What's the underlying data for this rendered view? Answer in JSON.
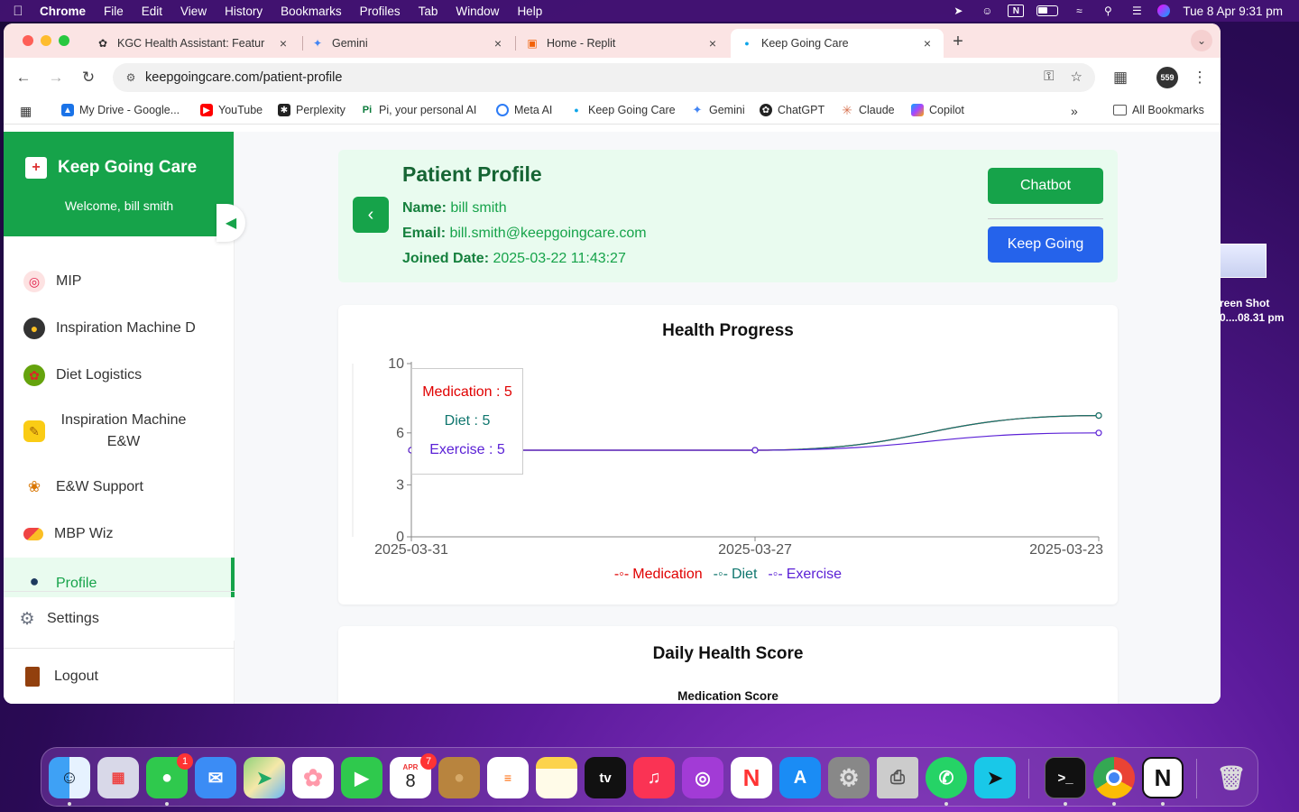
{
  "menubar": {
    "app": "Chrome",
    "items": [
      "File",
      "Edit",
      "View",
      "History",
      "Bookmarks",
      "Profiles",
      "Tab",
      "Window",
      "Help"
    ],
    "datetime": "Tue 8 Apr  9:31 pm"
  },
  "desktop": {
    "file_label_1": "reen Shot",
    "file_label_2": "0....08.31 pm"
  },
  "tabs": [
    {
      "title": "KGC Health Assistant: Featur",
      "icon": "kgc-icon"
    },
    {
      "title": "Gemini",
      "icon": "gemini-icon"
    },
    {
      "title": "Home - Replit",
      "icon": "replit-icon"
    },
    {
      "title": "Keep Going Care",
      "icon": "kgc-dot-icon"
    }
  ],
  "address": {
    "url": "keepgoingcare.com/patient-profile"
  },
  "extension_badge": "559",
  "bookmarks": [
    {
      "label": "My Drive - Google...",
      "color": "#1a73e8"
    },
    {
      "label": "YouTube",
      "color": "#ff0000"
    },
    {
      "label": "Perplexity",
      "color": "#222222"
    },
    {
      "label": "Pi, your personal AI",
      "color": "#0a7a3a"
    },
    {
      "label": "Meta AI",
      "color": "#2d7cf6"
    },
    {
      "label": "Keep Going Care",
      "color": "#0ea5e9"
    },
    {
      "label": "Gemini",
      "color": "#4285f4"
    },
    {
      "label": "ChatGPT",
      "color": "#222222"
    },
    {
      "label": "Claude",
      "color": "#d97757"
    },
    {
      "label": "Copilot",
      "color": "#8b5cf6"
    }
  ],
  "all_bookmarks": "All Bookmarks",
  "sidebar": {
    "brand": "Keep Going Care",
    "welcome": "Welcome, bill smith",
    "items": [
      {
        "label": "MIP",
        "icon": "target-icon"
      },
      {
        "label": "Inspiration Machine D",
        "icon": "frying-pan-icon"
      },
      {
        "label": "Diet Logistics",
        "icon": "salad-icon"
      },
      {
        "label": "Inspiration Machine E&W",
        "icon": "flexed-arm-icon"
      },
      {
        "label": "E&W Support",
        "icon": "runner-icon"
      },
      {
        "label": "MBP Wiz",
        "icon": "pill-icon"
      },
      {
        "label": "Profile",
        "icon": "user-icon"
      },
      {
        "label": "Settings",
        "icon": "gear-icon"
      },
      {
        "label": "Logout",
        "icon": "door-icon"
      }
    ]
  },
  "profile": {
    "title": "Patient Profile",
    "name_label": "Name:",
    "name": "bill smith",
    "email_label": "Email:",
    "email": "bill.smith@keepgoingcare.com",
    "joined_label": "Joined Date:",
    "joined": "2025-03-22 11:43:27",
    "chatbot_button": "Chatbot",
    "keepgoing_button": "Keep Going"
  },
  "chart_data": {
    "type": "line",
    "title": "Health Progress",
    "x": [
      "2025-03-31",
      "2025-03-27",
      "2025-03-23"
    ],
    "yticks": [
      0,
      3,
      6,
      10
    ],
    "ylim": [
      0,
      10
    ],
    "series": [
      {
        "name": "Medication",
        "color": "#e00000",
        "values": [
          5,
          5,
          7
        ]
      },
      {
        "name": "Diet",
        "color": "#0f766e",
        "values": [
          5,
          5,
          7
        ]
      },
      {
        "name": "Exercise",
        "color": "#5b21d6",
        "values": [
          5,
          5,
          6
        ]
      }
    ],
    "tooltip": [
      {
        "text": "Medication : 5",
        "color": "#e00000"
      },
      {
        "text": "Diet : 5",
        "color": "#0f766e"
      },
      {
        "text": "Exercise : 5",
        "color": "#5b21d6"
      }
    ],
    "legend_position": "bottom"
  },
  "daily": {
    "title": "Daily Health Score",
    "subtitle": "Medication Score"
  },
  "dock": {
    "apps": [
      "finder",
      "launchpad",
      "messages",
      "mail",
      "maps",
      "photos",
      "facetime",
      "calendar",
      "contacts",
      "reminders",
      "notes",
      "tv",
      "music",
      "podcasts",
      "news",
      "app-store",
      "system-settings",
      "printer",
      "whatsapp",
      "perplexity",
      "terminal",
      "chrome",
      "notion",
      "trash"
    ],
    "messages_badge": "1",
    "calendar_badge": "7",
    "calendar_month": "APR",
    "calendar_day": "8"
  }
}
